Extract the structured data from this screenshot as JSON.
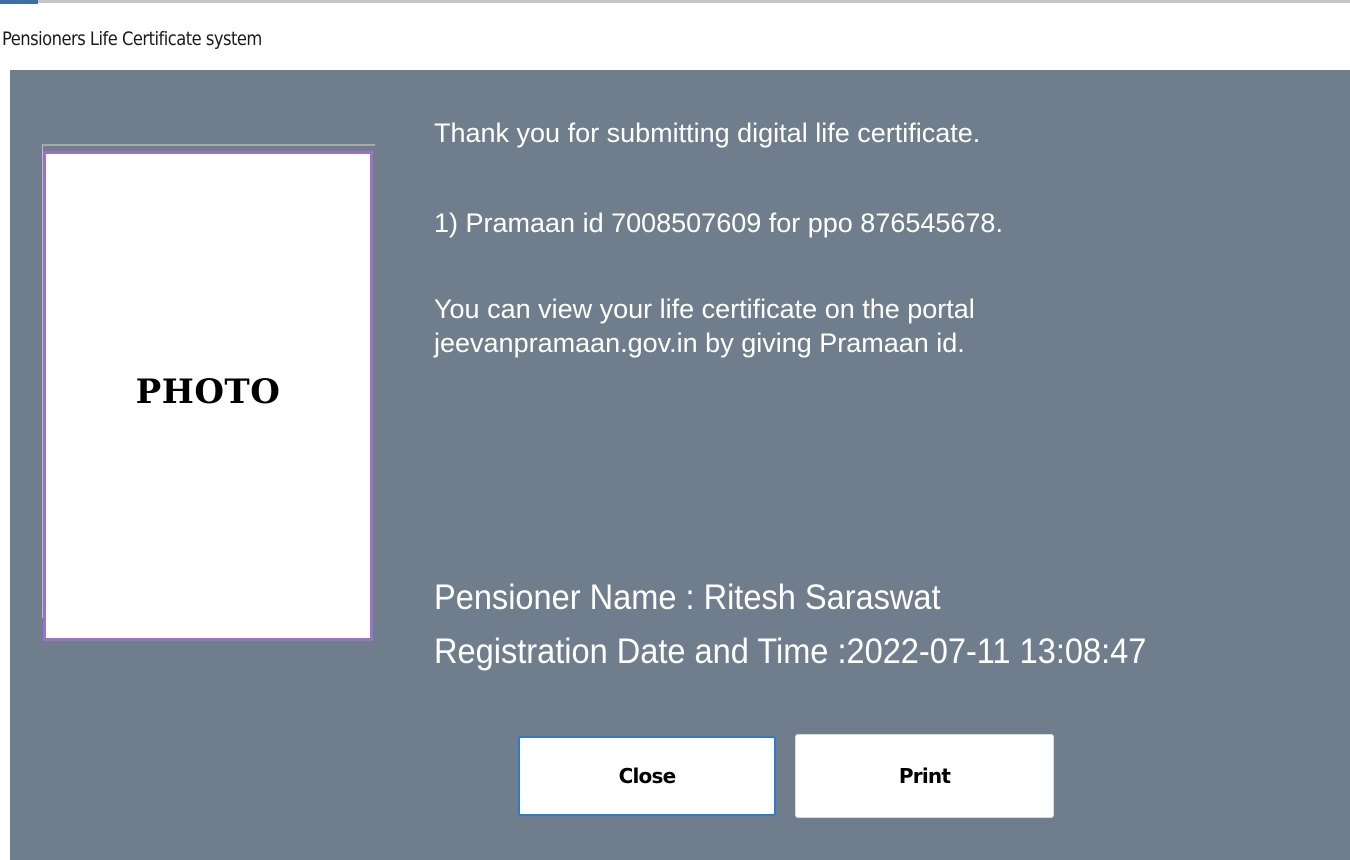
{
  "window": {
    "title": "Pensioners Life Certificate system"
  },
  "photo": {
    "label": "PHOTO"
  },
  "message": {
    "line1": "Thank you for submitting digital life certificate.",
    "line2": "1) Pramaan id 7008507609 for ppo 876545678.",
    "line3": "You can view your life certificate on the portal",
    "line4": "jeevanpramaan.gov.in by giving Pramaan id."
  },
  "pensioner": {
    "name_line": "Pensioner Name : Ritesh Saraswat",
    "registration_line": "Registration Date and Time :2022-07-11 13:08:47"
  },
  "buttons": {
    "close_label": "Close",
    "print_label": "Print"
  },
  "colors": {
    "panel_background": "#6f7d8c",
    "photo_border": "#9a73c6",
    "focus_border": "#2f7ad1",
    "text": "#ffffff"
  }
}
